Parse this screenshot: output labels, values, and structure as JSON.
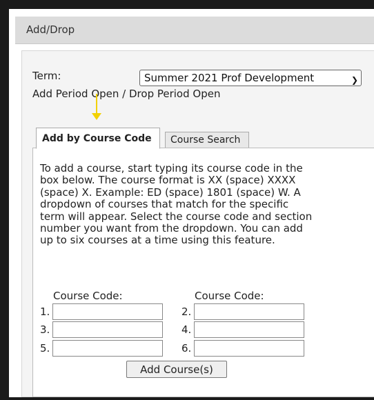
{
  "window": {
    "title": "Add/Drop"
  },
  "term": {
    "label": "Term:",
    "selected": "Summer 2021 Prof Development",
    "period_status": "Add Period Open / Drop Period Open"
  },
  "tabs": [
    {
      "label": "Add by Course Code",
      "active": true
    },
    {
      "label": "Course Search",
      "active": false
    }
  ],
  "add_by_code": {
    "instructions": "To add a course, start typing its course code in the box below. The course format is XX (space) XXXX (space) X. Example: ED (space) 1801 (space) W. A dropdown of courses that match for the specific term will appear. Select the course code and section number you want from the dropdown. You can add up to six courses at a time using this feature.",
    "column_heading": "Course Code:",
    "rows": [
      {
        "num": "1.",
        "value": ""
      },
      {
        "num": "2.",
        "value": ""
      },
      {
        "num": "3.",
        "value": ""
      },
      {
        "num": "4.",
        "value": ""
      },
      {
        "num": "5.",
        "value": ""
      },
      {
        "num": "6.",
        "value": ""
      }
    ],
    "submit_label": "Add Course(s)"
  },
  "annotation": {
    "arrow_color": "#f2d100"
  }
}
